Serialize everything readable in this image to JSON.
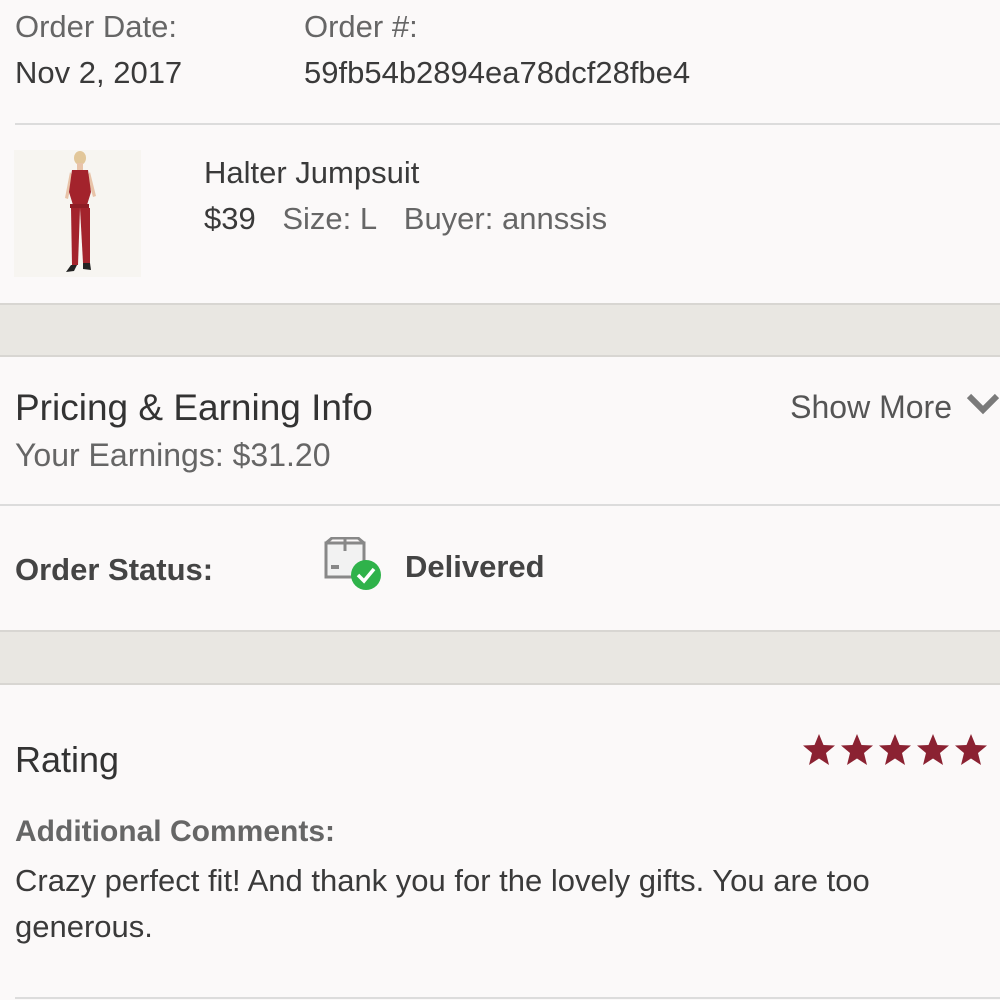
{
  "order": {
    "date_label": "Order Date:",
    "date_value": "Nov 2, 2017",
    "number_label": "Order #:",
    "number_value": "59fb54b2894ea78dcf28fbe4"
  },
  "item": {
    "title": "Halter Jumpsuit",
    "price": "$39",
    "size": "Size: L",
    "buyer": "Buyer: annssis"
  },
  "pricing": {
    "title": "Pricing & Earning Info",
    "earnings": "Your Earnings: $31.20",
    "show_more_label": "Show More",
    "show_more_icon": "chevron-down-icon"
  },
  "status": {
    "label": "Order Status:",
    "value": "Delivered",
    "icon": "package-delivered-icon",
    "icon_check_color": "#2fb24a"
  },
  "rating": {
    "title": "Rating",
    "stars": 5,
    "stars_max": 5,
    "star_color": "#8b2232",
    "comments_label": "Additional Comments:",
    "comments_text": "Crazy perfect fit! And thank you for the lovely gifts. You are too generous."
  },
  "colors": {
    "background": "#fbf9f9",
    "band": "#e9e7e2",
    "product_red": "#a3232c"
  }
}
